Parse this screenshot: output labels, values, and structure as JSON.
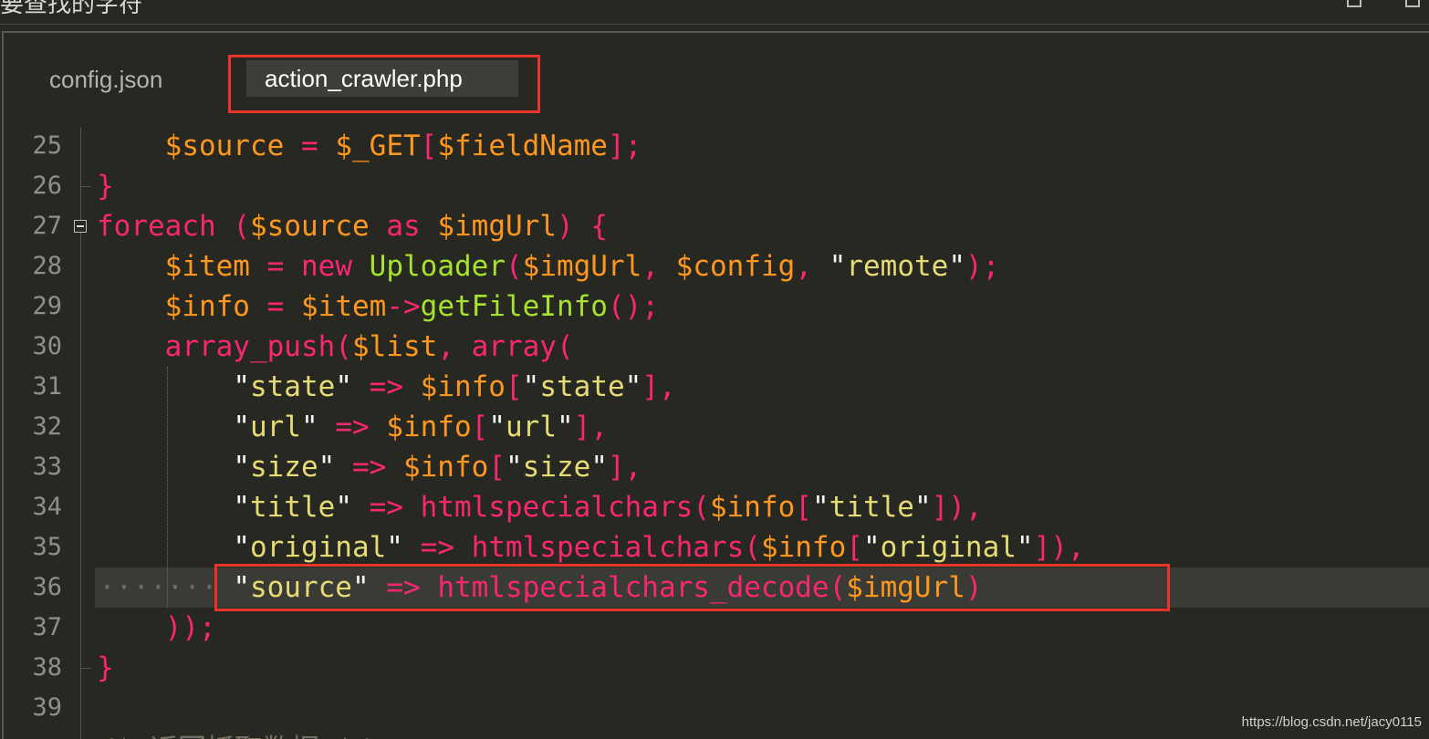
{
  "window": {
    "title": "要查找的字符"
  },
  "tabs": [
    {
      "label": "config.json",
      "active": false
    },
    {
      "label": "action_crawler.php",
      "active": true
    }
  ],
  "lines": [
    {
      "num": "25",
      "tokens": [
        {
          "t": "    "
        },
        {
          "t": "$source",
          "c": "v"
        },
        {
          "t": " "
        },
        {
          "t": "=",
          "c": "k"
        },
        {
          "t": " "
        },
        {
          "t": "$_GET",
          "c": "v"
        },
        {
          "t": "[",
          "c": "k"
        },
        {
          "t": "$fieldName",
          "c": "v"
        },
        {
          "t": "]",
          "c": "k"
        },
        {
          "t": ";",
          "c": "k"
        }
      ]
    },
    {
      "num": "26",
      "tokens": [
        {
          "t": "}",
          "c": "k"
        }
      ]
    },
    {
      "num": "27",
      "fold": true,
      "tokens": [
        {
          "t": "foreach",
          "c": "k"
        },
        {
          "t": " "
        },
        {
          "t": "(",
          "c": "k"
        },
        {
          "t": "$source",
          "c": "v"
        },
        {
          "t": " "
        },
        {
          "t": "as",
          "c": "k"
        },
        {
          "t": " "
        },
        {
          "t": "$imgUrl",
          "c": "v"
        },
        {
          "t": ")",
          "c": "k"
        },
        {
          "t": " "
        },
        {
          "t": "{",
          "c": "k"
        }
      ]
    },
    {
      "num": "28",
      "tokens": [
        {
          "t": "    "
        },
        {
          "t": "$item",
          "c": "v"
        },
        {
          "t": " "
        },
        {
          "t": "=",
          "c": "k"
        },
        {
          "t": " "
        },
        {
          "t": "new",
          "c": "k"
        },
        {
          "t": " "
        },
        {
          "t": "Uploader",
          "c": "c"
        },
        {
          "t": "(",
          "c": "k"
        },
        {
          "t": "$imgUrl",
          "c": "v"
        },
        {
          "t": ",",
          "c": "k"
        },
        {
          "t": " "
        },
        {
          "t": "$config",
          "c": "v"
        },
        {
          "t": ",",
          "c": "k"
        },
        {
          "t": " "
        },
        {
          "t": "\"",
          "c": "p"
        },
        {
          "t": "remote",
          "c": "s"
        },
        {
          "t": "\"",
          "c": "p"
        },
        {
          "t": ")",
          "c": "k"
        },
        {
          "t": ";",
          "c": "k"
        }
      ]
    },
    {
      "num": "29",
      "tokens": [
        {
          "t": "    "
        },
        {
          "t": "$info",
          "c": "v"
        },
        {
          "t": " "
        },
        {
          "t": "=",
          "c": "k"
        },
        {
          "t": " "
        },
        {
          "t": "$item",
          "c": "v"
        },
        {
          "t": "->",
          "c": "k"
        },
        {
          "t": "getFileInfo",
          "c": "c"
        },
        {
          "t": "(",
          "c": "k"
        },
        {
          "t": ")",
          "c": "k"
        },
        {
          "t": ";",
          "c": "k"
        }
      ]
    },
    {
      "num": "30",
      "tokens": [
        {
          "t": "    "
        },
        {
          "t": "array_push",
          "c": "k"
        },
        {
          "t": "(",
          "c": "k"
        },
        {
          "t": "$list",
          "c": "v"
        },
        {
          "t": ",",
          "c": "k"
        },
        {
          "t": " "
        },
        {
          "t": "array",
          "c": "k"
        },
        {
          "t": "(",
          "c": "k"
        }
      ]
    },
    {
      "num": "31",
      "tokens": [
        {
          "t": "        "
        },
        {
          "t": "\"",
          "c": "p"
        },
        {
          "t": "state",
          "c": "s"
        },
        {
          "t": "\"",
          "c": "p"
        },
        {
          "t": " "
        },
        {
          "t": "=>",
          "c": "k"
        },
        {
          "t": " "
        },
        {
          "t": "$info",
          "c": "v"
        },
        {
          "t": "[",
          "c": "k"
        },
        {
          "t": "\"",
          "c": "p"
        },
        {
          "t": "state",
          "c": "s"
        },
        {
          "t": "\"",
          "c": "p"
        },
        {
          "t": "]",
          "c": "k"
        },
        {
          "t": ",",
          "c": "k"
        }
      ]
    },
    {
      "num": "32",
      "tokens": [
        {
          "t": "        "
        },
        {
          "t": "\"",
          "c": "p"
        },
        {
          "t": "url",
          "c": "s"
        },
        {
          "t": "\"",
          "c": "p"
        },
        {
          "t": " "
        },
        {
          "t": "=>",
          "c": "k"
        },
        {
          "t": " "
        },
        {
          "t": "$info",
          "c": "v"
        },
        {
          "t": "[",
          "c": "k"
        },
        {
          "t": "\"",
          "c": "p"
        },
        {
          "t": "url",
          "c": "s"
        },
        {
          "t": "\"",
          "c": "p"
        },
        {
          "t": "]",
          "c": "k"
        },
        {
          "t": ",",
          "c": "k"
        }
      ]
    },
    {
      "num": "33",
      "tokens": [
        {
          "t": "        "
        },
        {
          "t": "\"",
          "c": "p"
        },
        {
          "t": "size",
          "c": "s"
        },
        {
          "t": "\"",
          "c": "p"
        },
        {
          "t": " "
        },
        {
          "t": "=>",
          "c": "k"
        },
        {
          "t": " "
        },
        {
          "t": "$info",
          "c": "v"
        },
        {
          "t": "[",
          "c": "k"
        },
        {
          "t": "\"",
          "c": "p"
        },
        {
          "t": "size",
          "c": "s"
        },
        {
          "t": "\"",
          "c": "p"
        },
        {
          "t": "]",
          "c": "k"
        },
        {
          "t": ",",
          "c": "k"
        }
      ]
    },
    {
      "num": "34",
      "tokens": [
        {
          "t": "        "
        },
        {
          "t": "\"",
          "c": "p"
        },
        {
          "t": "title",
          "c": "s"
        },
        {
          "t": "\"",
          "c": "p"
        },
        {
          "t": " "
        },
        {
          "t": "=>",
          "c": "k"
        },
        {
          "t": " "
        },
        {
          "t": "htmlspecialchars",
          "c": "k"
        },
        {
          "t": "(",
          "c": "k"
        },
        {
          "t": "$info",
          "c": "v"
        },
        {
          "t": "[",
          "c": "k"
        },
        {
          "t": "\"",
          "c": "p"
        },
        {
          "t": "title",
          "c": "s"
        },
        {
          "t": "\"",
          "c": "p"
        },
        {
          "t": "]",
          "c": "k"
        },
        {
          "t": ")",
          "c": "k"
        },
        {
          "t": ",",
          "c": "k"
        }
      ]
    },
    {
      "num": "35",
      "tokens": [
        {
          "t": "        "
        },
        {
          "t": "\"",
          "c": "p"
        },
        {
          "t": "original",
          "c": "s"
        },
        {
          "t": "\"",
          "c": "p"
        },
        {
          "t": " "
        },
        {
          "t": "=>",
          "c": "k"
        },
        {
          "t": " "
        },
        {
          "t": "htmlspecialchars",
          "c": "k"
        },
        {
          "t": "(",
          "c": "k"
        },
        {
          "t": "$info",
          "c": "v"
        },
        {
          "t": "[",
          "c": "k"
        },
        {
          "t": "\"",
          "c": "p"
        },
        {
          "t": "original",
          "c": "s"
        },
        {
          "t": "\"",
          "c": "p"
        },
        {
          "t": "]",
          "c": "k"
        },
        {
          "t": ")",
          "c": "k"
        },
        {
          "t": ",",
          "c": "k"
        }
      ]
    },
    {
      "num": "36",
      "highlight": true,
      "tokens": [
        {
          "t": "        "
        },
        {
          "t": "\"",
          "c": "p"
        },
        {
          "t": "source",
          "c": "s"
        },
        {
          "t": "\"",
          "c": "p"
        },
        {
          "t": " "
        },
        {
          "t": "=>",
          "c": "k"
        },
        {
          "t": " "
        },
        {
          "t": "htmlspecialchars_decode",
          "c": "k"
        },
        {
          "t": "(",
          "c": "k"
        },
        {
          "t": "$imgUrl",
          "c": "v"
        },
        {
          "t": ")",
          "c": "k"
        }
      ]
    },
    {
      "num": "37",
      "tokens": [
        {
          "t": "    "
        },
        {
          "t": ")",
          "c": "k"
        },
        {
          "t": ")",
          "c": "k"
        },
        {
          "t": ";",
          "c": "k"
        }
      ]
    },
    {
      "num": "38",
      "tokens": [
        {
          "t": "}",
          "c": "k"
        }
      ]
    },
    {
      "num": "39",
      "tokens": []
    }
  ],
  "next_line_partial": "/* 返回抓取数据 */",
  "watermark": "https://blog.csdn.net/jacy0115",
  "colors": {
    "background": "#272822",
    "variable": "#fd971f",
    "keyword": "#f92672",
    "string": "#e6db74",
    "class": "#a6e22e",
    "highlight_box": "#e8342c"
  }
}
